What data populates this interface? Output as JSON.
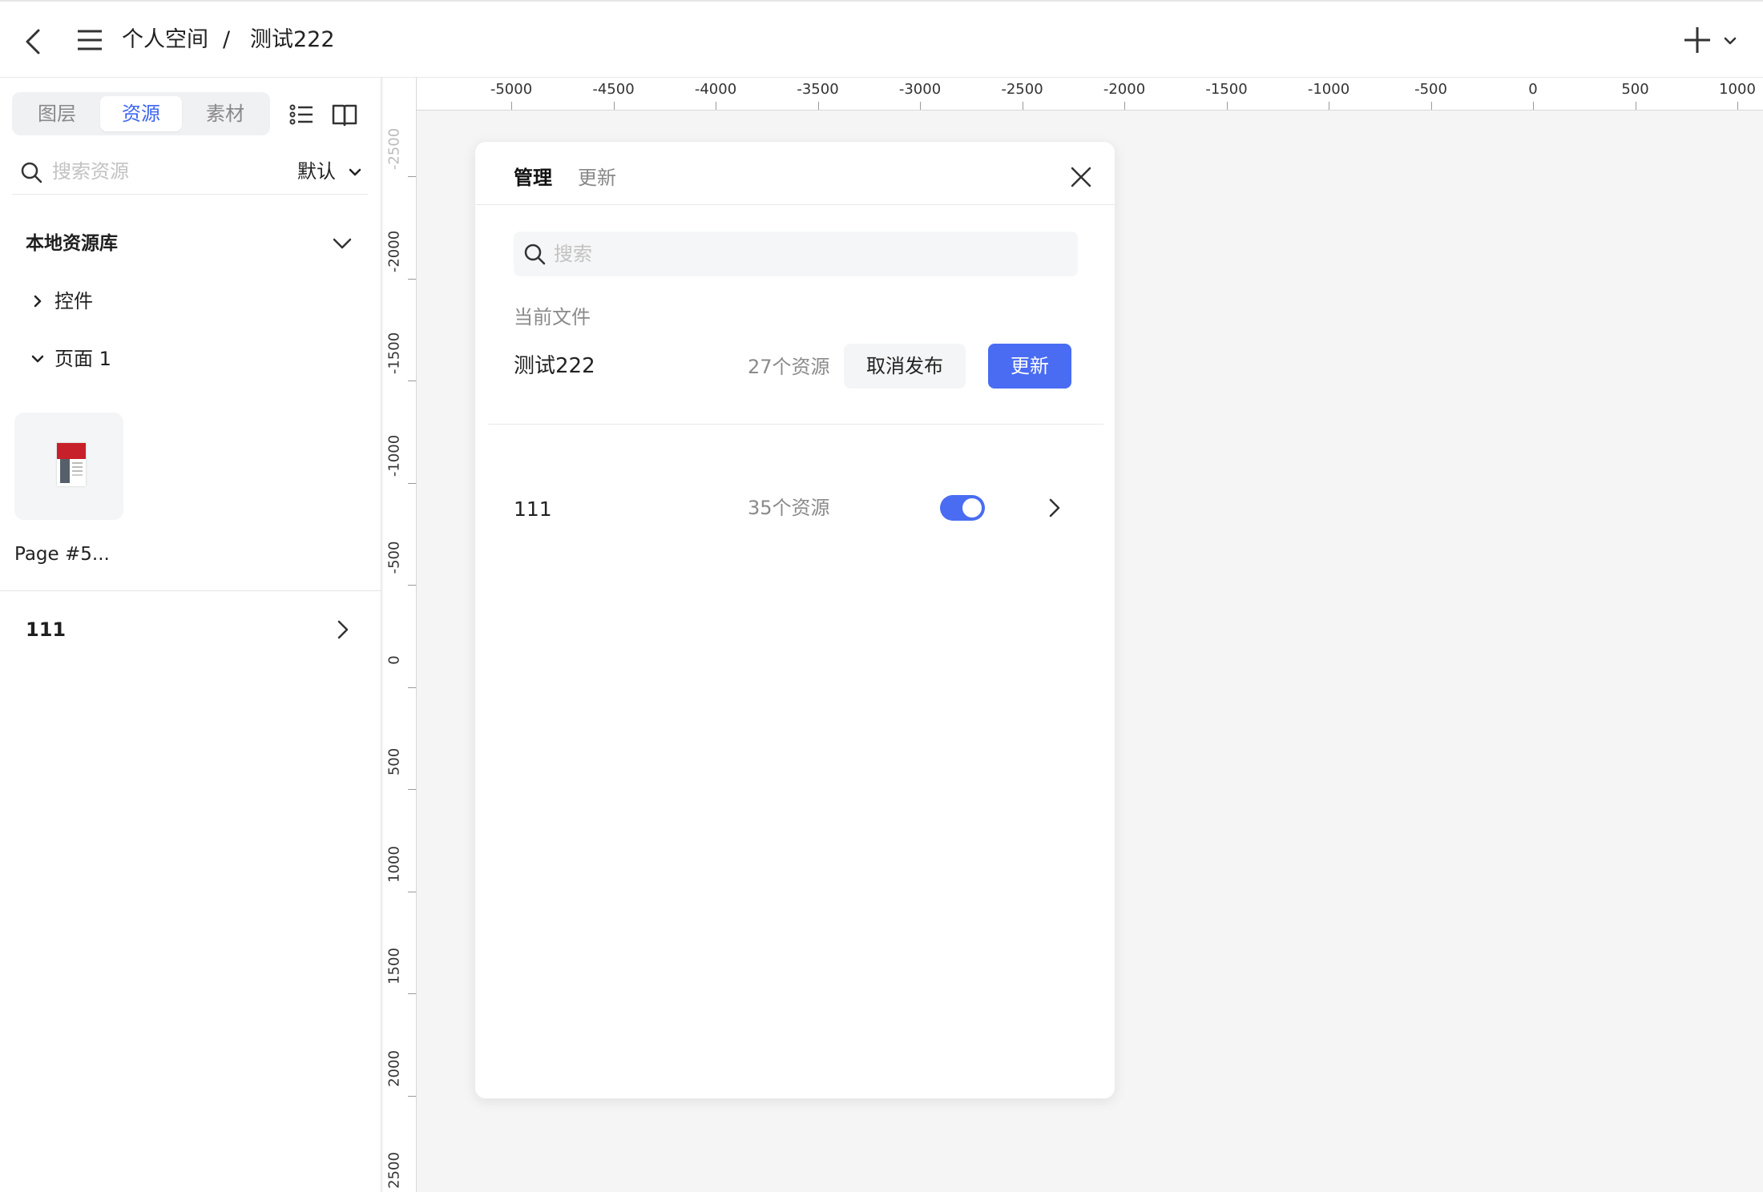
{
  "header": {
    "breadcrumb": [
      "个人空间",
      "/",
      "测试222"
    ]
  },
  "left_panel": {
    "tabs": [
      "图层",
      "资源",
      "素材"
    ],
    "active_tab": "资源",
    "search_placeholder": "搜索资源",
    "sort_label": "默认",
    "library_title": "本地资源库",
    "tree": [
      {
        "label": "控件",
        "expanded": false
      },
      {
        "label": "页面 1",
        "expanded": true
      }
    ],
    "thumbnail_name": "Page #5...",
    "library_item": "111"
  },
  "ruler": {
    "h_ticks": [
      "-5000",
      "-4500",
      "-4000",
      "-3500",
      "-3000",
      "-2500",
      "-2000",
      "-1500",
      "-1000",
      "-500",
      "0",
      "500",
      "1000"
    ],
    "v_ticks": [
      "-2500",
      "-2000",
      "-1500",
      "-1000",
      "-500",
      "0",
      "500",
      "1000",
      "1500",
      "2000",
      "2500"
    ]
  },
  "modal": {
    "tabs": [
      "管理",
      "更新"
    ],
    "search_placeholder": "搜索",
    "section_label": "当前文件",
    "file_name": "测试222",
    "file_count": "27个资源",
    "unpublish_label": "取消发布",
    "update_label": "更新",
    "library_name": "111",
    "library_count": "35个资源",
    "library_enabled": true
  },
  "colors": {
    "accent": "#4a6cf2",
    "active_tab_text": "#3c64f0"
  }
}
